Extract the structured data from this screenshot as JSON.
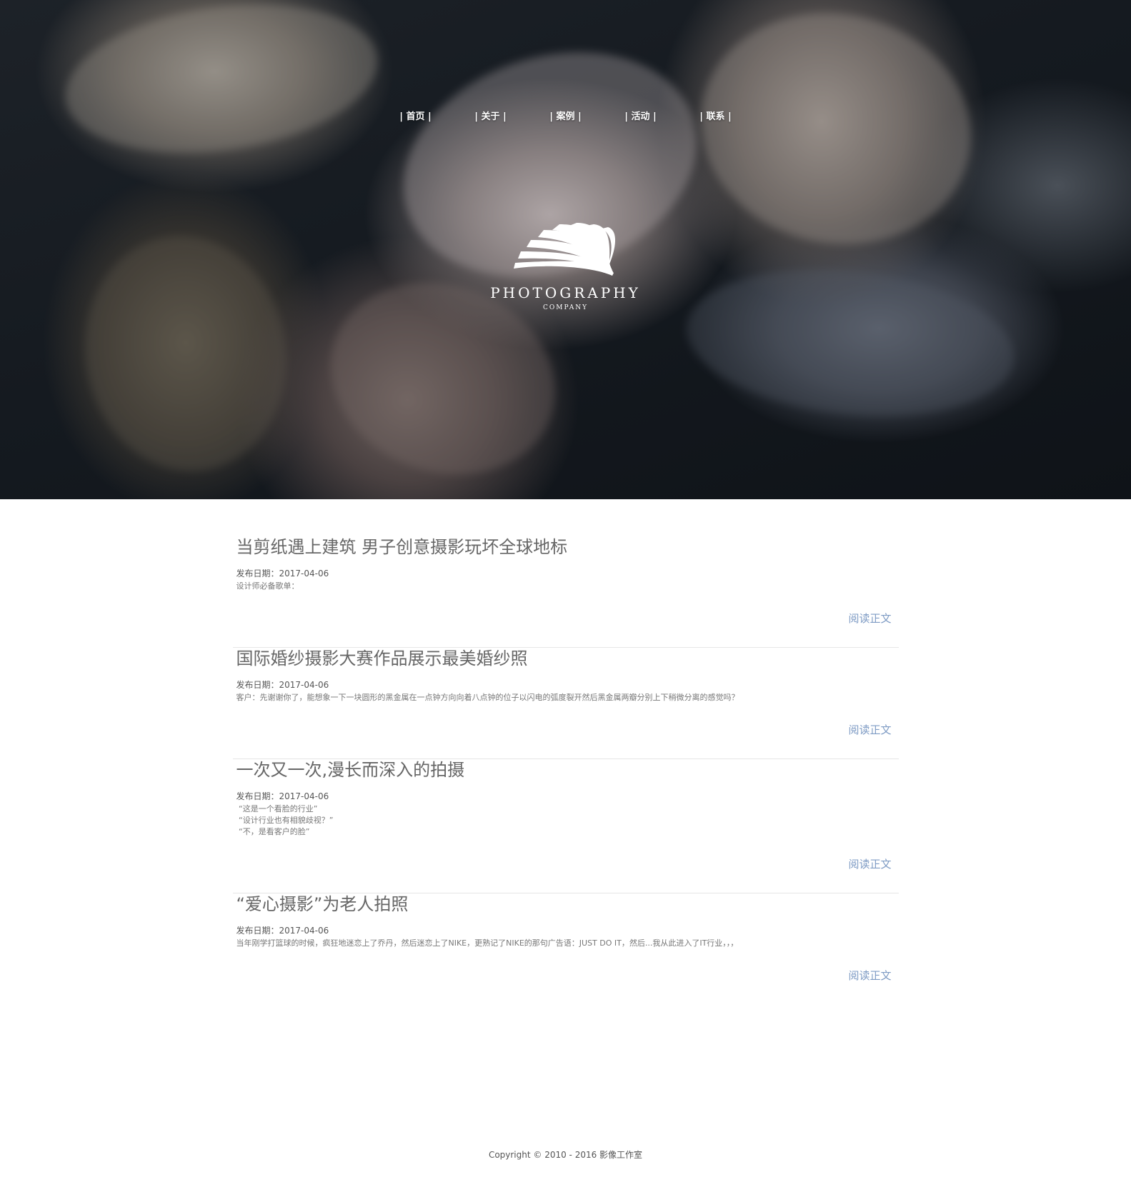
{
  "nav": {
    "items": [
      {
        "label": "| 首页 |"
      },
      {
        "label": "| 关于 |"
      },
      {
        "label": "| 案例 |"
      },
      {
        "label": "| 活动 |"
      },
      {
        "label": "| 联系 |"
      }
    ]
  },
  "logo": {
    "icon": "shell-fan-icon",
    "title": "PHOTOGRAPHY",
    "subtitle": "COMPANY"
  },
  "articles": [
    {
      "title": "当剪纸遇上建筑 男子创意摄影玩坏全球地标",
      "date": "发布日期：2017-04-06",
      "summary": [
        "设计师必备歌单："
      ],
      "read_more": "阅读正文"
    },
    {
      "title": "国际婚纱摄影大赛作品展示最美婚纱照",
      "date": "发布日期：2017-04-06",
      "summary": [
        "客户：先谢谢你了，能想象一下一块圆形的黑金属在一点钟方向向着八点钟的位子以闪电的弧度裂开然后黑金属两瓣分别上下稍微分离的感觉吗？"
      ],
      "read_more": "阅读正文"
    },
    {
      "title": "一次又一次,漫长而深入的拍摄",
      "date": "发布日期：2017-04-06",
      "summary": [
        " “这是一个看脸的行业”",
        " “设计行业也有相貌歧视？”",
        " “不，是看客户的脸”"
      ],
      "read_more": "阅读正文"
    },
    {
      "title": "“爱心摄影”为老人拍照",
      "date": "发布日期：2017-04-06",
      "summary": [
        "当年刚学打篮球的时候，疯狂地迷恋上了乔丹，然后迷恋上了NIKE，更熟记了NIKE的那句广告语：JUST DO IT，然后...我从此进入了IT行业，，，"
      ],
      "read_more": "阅读正文"
    }
  ],
  "footer": {
    "copyright": "Copyright © 2010 - 2016 影像工作室"
  }
}
